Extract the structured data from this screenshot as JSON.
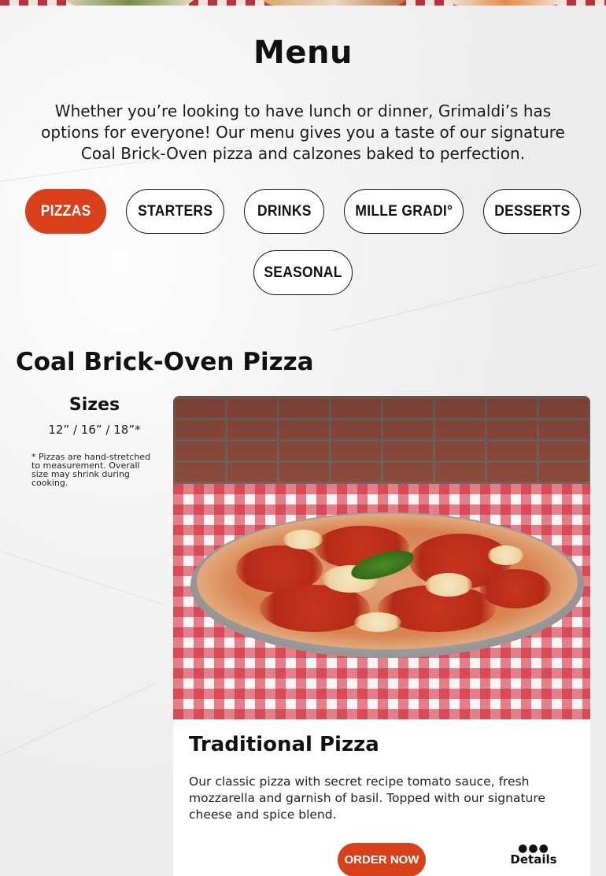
{
  "page": {
    "title": "Menu",
    "intro": "Whether you’re looking to have lunch or dinner, Grimaldi’s has options for everyone! Our menu gives you a taste of our signature Coal Brick-Oven pizza and calzones baked to perfection."
  },
  "tabs": [
    {
      "label": "Pizzas",
      "active": true
    },
    {
      "label": "Starters",
      "active": false
    },
    {
      "label": "Drinks",
      "active": false
    },
    {
      "label": "Mille Gradi°",
      "active": false
    },
    {
      "label": "Desserts",
      "active": false
    },
    {
      "label": "Seasonal",
      "active": false
    }
  ],
  "section": {
    "title": "Coal Brick-Oven Pizza",
    "sizes_heading": "Sizes",
    "sizes_values": "12” / 16” / 18”*",
    "sizes_note": "* Pizzas are hand-stretched to measurement. Overall size may shrink during cooking."
  },
  "item": {
    "name": "Traditional Pizza",
    "description": "Our classic pizza with secret recipe tomato sauce, fresh mozzarella and garnish of basil. Topped with our signature cheese and spice blend.",
    "order_label": "Order Now",
    "details_label": "Details",
    "details_icon": "ellipsis-icon",
    "photo_icon": "pizza-photo"
  },
  "colors": {
    "accent": "#d9401a",
    "text": "#111111"
  }
}
